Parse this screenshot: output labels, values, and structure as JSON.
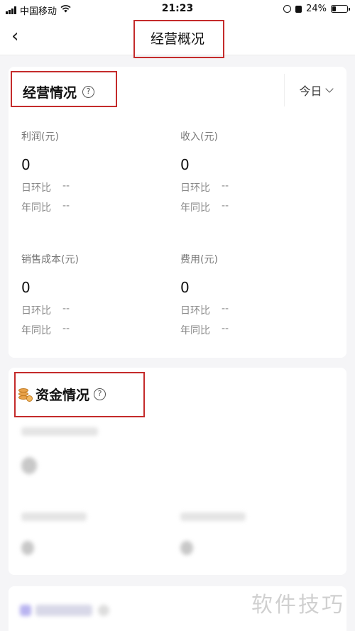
{
  "status_bar": {
    "carrier": "中国移动",
    "time": "21:23",
    "battery": "24%",
    "battery_level": 0.24
  },
  "nav": {
    "back_icon": "chevron-left-icon",
    "title": "经营概况"
  },
  "business": {
    "title": "经营情况",
    "period": "今日",
    "metrics": [
      {
        "label": "利润(元)",
        "value": "0",
        "dod_label": "日环比",
        "dod_value": "--",
        "yoy_label": "年同比",
        "yoy_value": "--"
      },
      {
        "label": "收入(元)",
        "value": "0",
        "dod_label": "日环比",
        "dod_value": "--",
        "yoy_label": "年同比",
        "yoy_value": "--"
      },
      {
        "label": "销售成本(元)",
        "value": "0",
        "dod_label": "日环比",
        "dod_value": "--",
        "yoy_label": "年同比",
        "yoy_value": "--"
      },
      {
        "label": "费用(元)",
        "value": "0",
        "dod_label": "日环比",
        "dod_value": "--",
        "yoy_label": "年同比",
        "yoy_value": "--"
      }
    ]
  },
  "funds": {
    "title": "资金情况",
    "icon": "coins-icon"
  },
  "watermark": "软件技巧",
  "colors": {
    "highlight": "#c42b2b",
    "coin": "#e8a24a"
  }
}
